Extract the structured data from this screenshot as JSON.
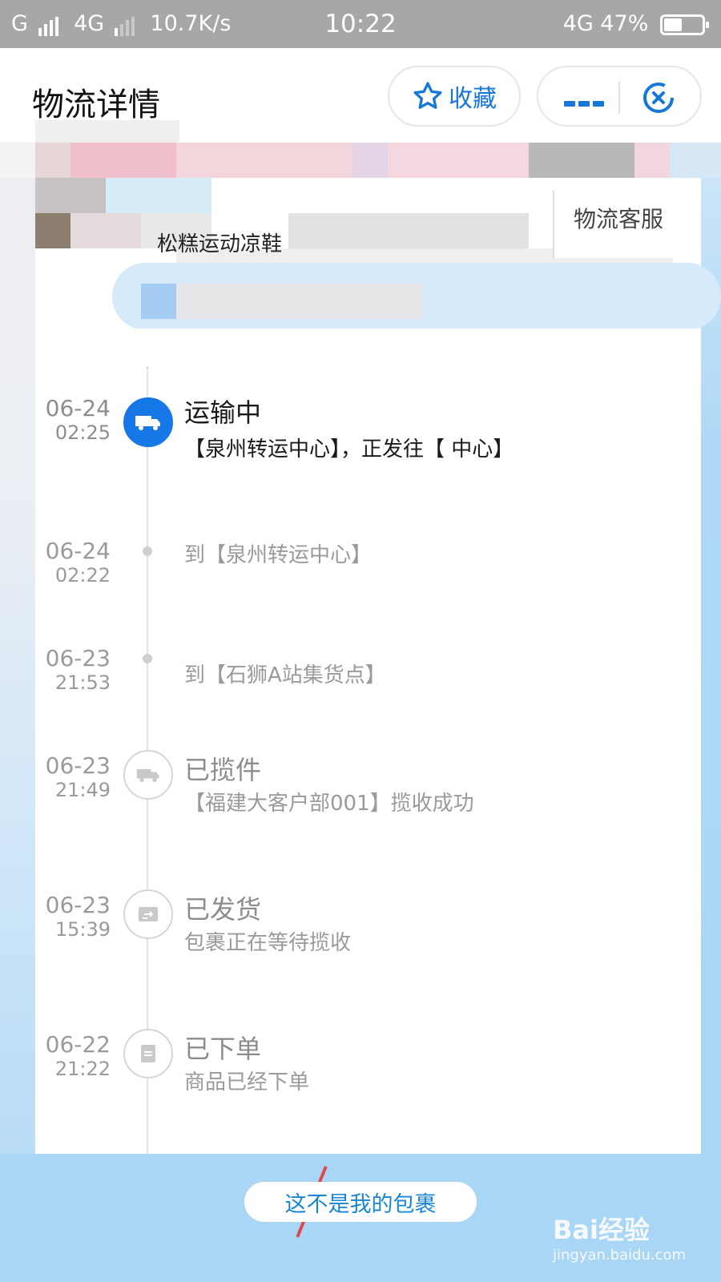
{
  "status_bar": {
    "carrier_left": "G",
    "network": "4G",
    "speed": "10.7K/s",
    "time": "10:22",
    "network_right": "4G",
    "battery": "47%"
  },
  "header": {
    "title": "物流详情",
    "favorite_label": "收藏",
    "accent_color": "#1677d9"
  },
  "package": {
    "product_text": "松糕运动凉鞋",
    "service_label": "物流客服"
  },
  "timeline": [
    {
      "date": "06-24",
      "time": "02:25",
      "title": "运输中",
      "desc": "【泉州转运中心】，正发往【            中心】",
      "icon": "truck-icon",
      "active": true
    },
    {
      "date": "06-24",
      "time": "02:22",
      "title": "",
      "desc": "到【泉州转运中心】",
      "icon": "dot",
      "active": false
    },
    {
      "date": "06-23",
      "time": "21:53",
      "title": "",
      "desc": "到【石狮A站集货点】",
      "icon": "dot",
      "active": false
    },
    {
      "date": "06-23",
      "time": "21:49",
      "title": "已揽件",
      "desc": "【福建大客户部001】揽收成功",
      "icon": "truck-icon",
      "active": false
    },
    {
      "date": "06-23",
      "time": "15:39",
      "title": "已发货",
      "desc": "包裹正在等待揽收",
      "icon": "ship-box-icon",
      "active": false
    },
    {
      "date": "06-22",
      "time": "21:22",
      "title": "已下单",
      "desc": "商品已经下单",
      "icon": "order-doc-icon",
      "active": false
    }
  ],
  "footer": {
    "not_mine_label": "这不是我的包裹",
    "watermark_main": "Bai经验",
    "watermark_sub": "jingyan.baidu.com"
  }
}
